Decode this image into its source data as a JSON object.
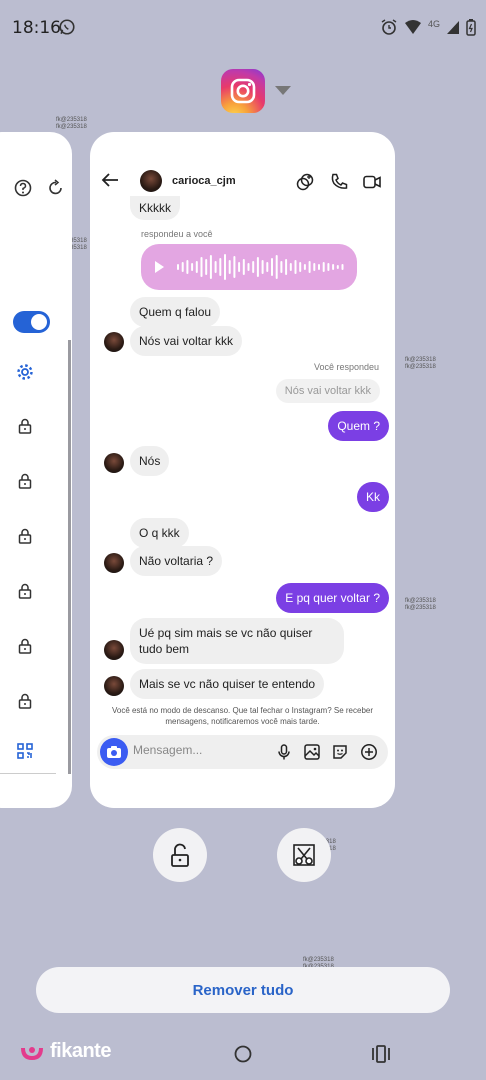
{
  "status_bar": {
    "time": "18:16",
    "network": "4G"
  },
  "watermarks": [
    "fk@235318",
    "fk@235318",
    "fk@235318",
    "fk@235318",
    "fk@235318",
    "fk@235318",
    "fk@235318",
    "fk@235318"
  ],
  "chat": {
    "contact_name": "carioca_cjm",
    "replied_to_you": "respondeu a você",
    "you_replied": "Você respondeu",
    "messages": {
      "m1": "Kkkkk",
      "m2": "Quem q falou",
      "m3": "Nós vai voltar kkk",
      "m4_quote": "Nós vai voltar kkk",
      "m4": "Quem ?",
      "m5": "Nós",
      "m6": "Kk",
      "m7": "O q kkk",
      "m8": "Não voltaria ?",
      "m9": "E pq quer voltar ?",
      "m10": "Ué pq sim mais se vc não quiser tudo bem",
      "m11": "Mais se vc não quiser te entendo"
    },
    "rest_mode_note": "Você está no modo de descanso. Que tal fechar o Instagram? Se receber mensagens, notificaremos você mais tarde.",
    "composer_placeholder": "Mensagem..."
  },
  "actions": {
    "remove_all": "Remover tudo"
  },
  "branding": {
    "logo_text": "fikante"
  },
  "colors": {
    "background": "#bbbdd0",
    "outgoing_bubble": "#7b3fe4",
    "voice_bubble": "#e3a6e2",
    "toggle": "#2563d6",
    "remove_all_text": "#2a64c8"
  }
}
